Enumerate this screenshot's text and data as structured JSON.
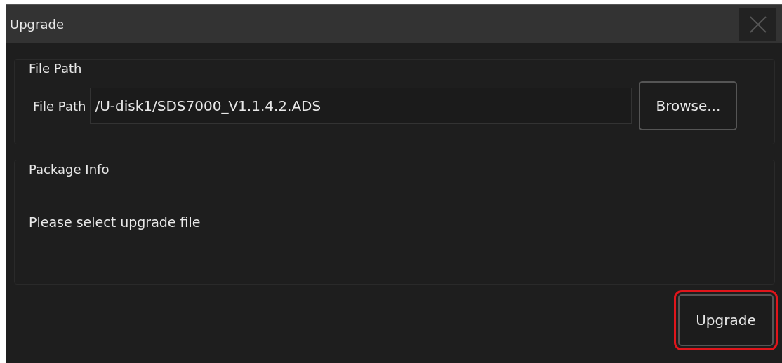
{
  "dialog": {
    "title": "Upgrade"
  },
  "file_group": {
    "title": "File Path",
    "field_label": "File Path",
    "value": "/U-disk1/SDS7000_V1.1.4.2.ADS",
    "browse": "Browse..."
  },
  "package_group": {
    "title": "Package Info",
    "message": "Please select upgrade file"
  },
  "upgrade_button": {
    "label": "Upgrade",
    "highlighted": true
  }
}
